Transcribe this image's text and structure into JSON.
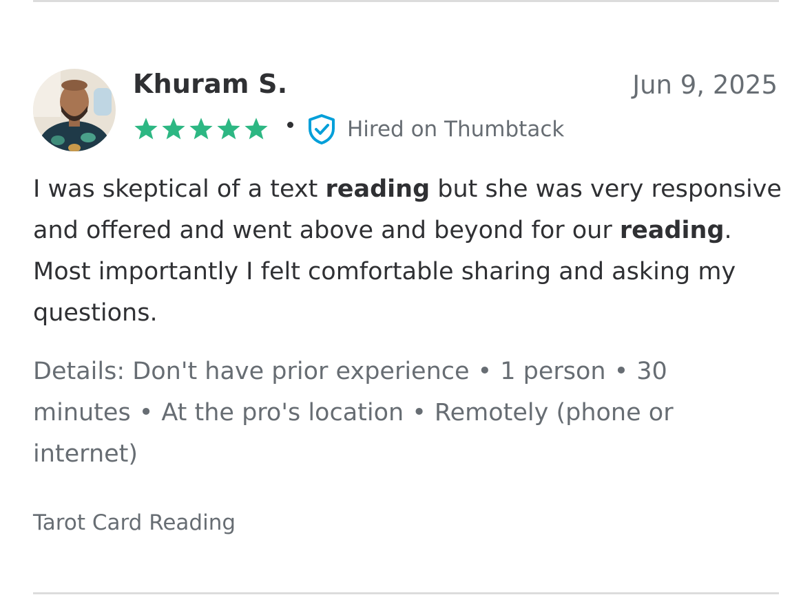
{
  "review": {
    "reviewer_name": "Khuram S.",
    "date": "Jun 9, 2025",
    "rating": 5,
    "hired_label": "Hired on Thumbtack",
    "text_parts": [
      {
        "text": "I was skeptical of a text ",
        "bold": false
      },
      {
        "text": "reading",
        "bold": true
      },
      {
        "text": " but she was very responsive and offered and went above and beyond for our ",
        "bold": false
      },
      {
        "text": "reading",
        "bold": true
      },
      {
        "text": ". Most importantly I felt comfortable sharing and asking my questions.",
        "bold": false
      }
    ],
    "details_prefix": "Details:",
    "details": [
      "Don't have prior experience",
      "1 person",
      "30 minutes",
      "At the pro's location",
      "Remotely (phone or internet)"
    ],
    "service": "Tarot Card Reading"
  },
  "colors": {
    "star": "#2db783",
    "shield": "#009fd9",
    "text_primary": "#2f3033",
    "text_secondary": "#676d73",
    "divider": "#dcdcdc"
  },
  "icons": {
    "star": "star-icon",
    "verified": "shield-check-icon"
  }
}
